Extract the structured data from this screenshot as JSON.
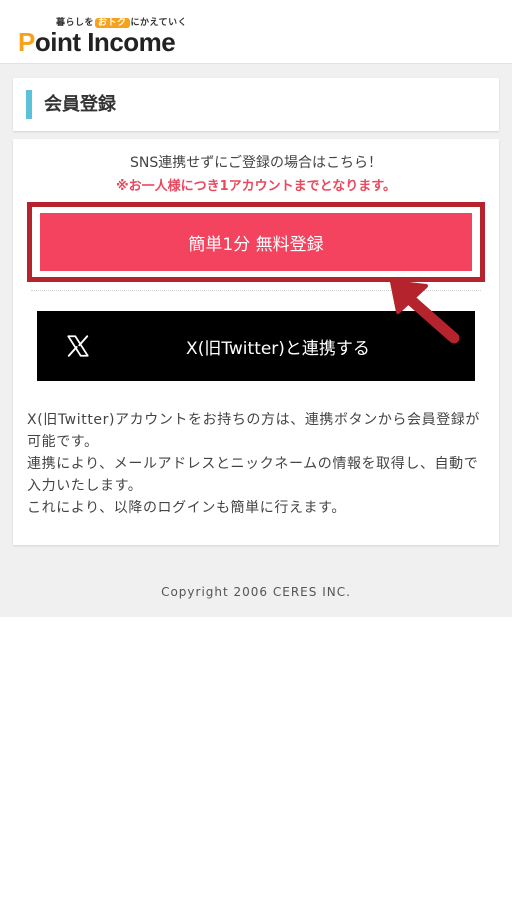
{
  "header": {
    "tagline_pre": "暮らしを",
    "tagline_highlight": "おトク",
    "tagline_post": "にかえていく",
    "logo_first_letter": "P",
    "logo_rest": "oint Income"
  },
  "page_title": "会員登録",
  "main": {
    "sns_note": "SNS連携せずにご登録の場合はこちら！",
    "limit_note": "※お一人様につき1アカウントまでとなります。",
    "register_button": "簡単1分 無料登録",
    "x_button": "X(旧Twitter)と連携する",
    "x_icon": "x-logo-icon",
    "description": [
      "X(旧Twitter)アカウントをお持ちの方は、連携ボタンから会員登録が可能です。",
      "連携により、メールアドレスとニックネームの情報を取得し、自動で入力いたします。",
      "これにより、以降のログインも簡単に行えます。"
    ]
  },
  "footer": {
    "copyright": "Copyright 2006 CERES INC."
  },
  "colors": {
    "brand_orange": "#f7a21b",
    "register_pink": "#f4435f",
    "highlight_red": "#b5232d",
    "notice_red": "#e8495e",
    "title_accent": "#5bc2d9",
    "x_black": "#000000"
  }
}
